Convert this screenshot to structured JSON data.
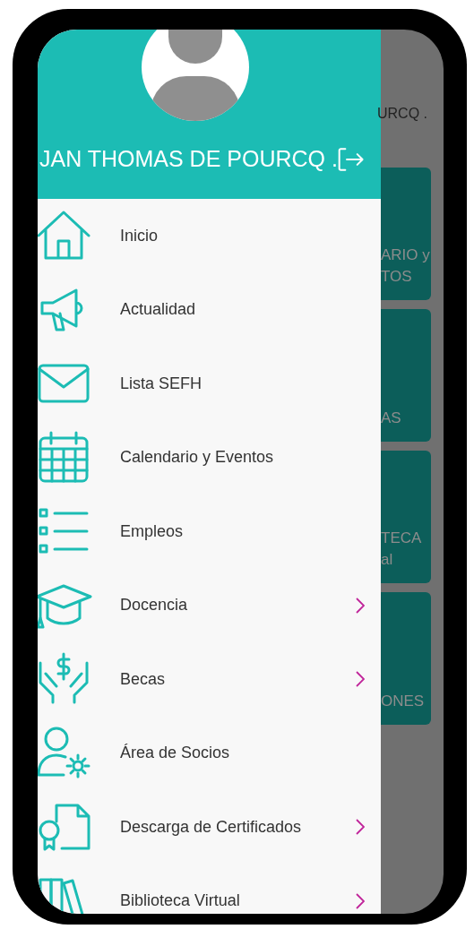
{
  "drawer": {
    "user_name": "JAN THOMAS DE POURCQ .",
    "menu": [
      {
        "label": "Inicio",
        "kind": "home",
        "has_submenu": false
      },
      {
        "label": "Actualidad",
        "kind": "megaphone",
        "has_submenu": false
      },
      {
        "label": "Lista SEFH",
        "kind": "envelope",
        "has_submenu": false
      },
      {
        "label": "Calendario y Eventos",
        "kind": "calendar",
        "has_submenu": false
      },
      {
        "label": "Empleos",
        "kind": "list",
        "has_submenu": false
      },
      {
        "label": "Docencia",
        "kind": "cap",
        "has_submenu": true
      },
      {
        "label": "Becas",
        "kind": "hands",
        "has_submenu": true
      },
      {
        "label": "Área de Socios",
        "kind": "usergear",
        "has_submenu": false
      },
      {
        "label": "Descarga de Certificados",
        "kind": "certificate",
        "has_submenu": true
      },
      {
        "label": "Biblioteca Virtual",
        "kind": "books",
        "has_submenu": true
      }
    ]
  },
  "background": {
    "header_text": "URCQ .",
    "tiles": [
      {
        "lines": [
          "ARIO y",
          "TOS"
        ]
      },
      {
        "lines": [
          "AS"
        ]
      },
      {
        "lines": [
          "TECA",
          "al"
        ]
      },
      {
        "lines": [
          "ONES"
        ]
      }
    ]
  }
}
